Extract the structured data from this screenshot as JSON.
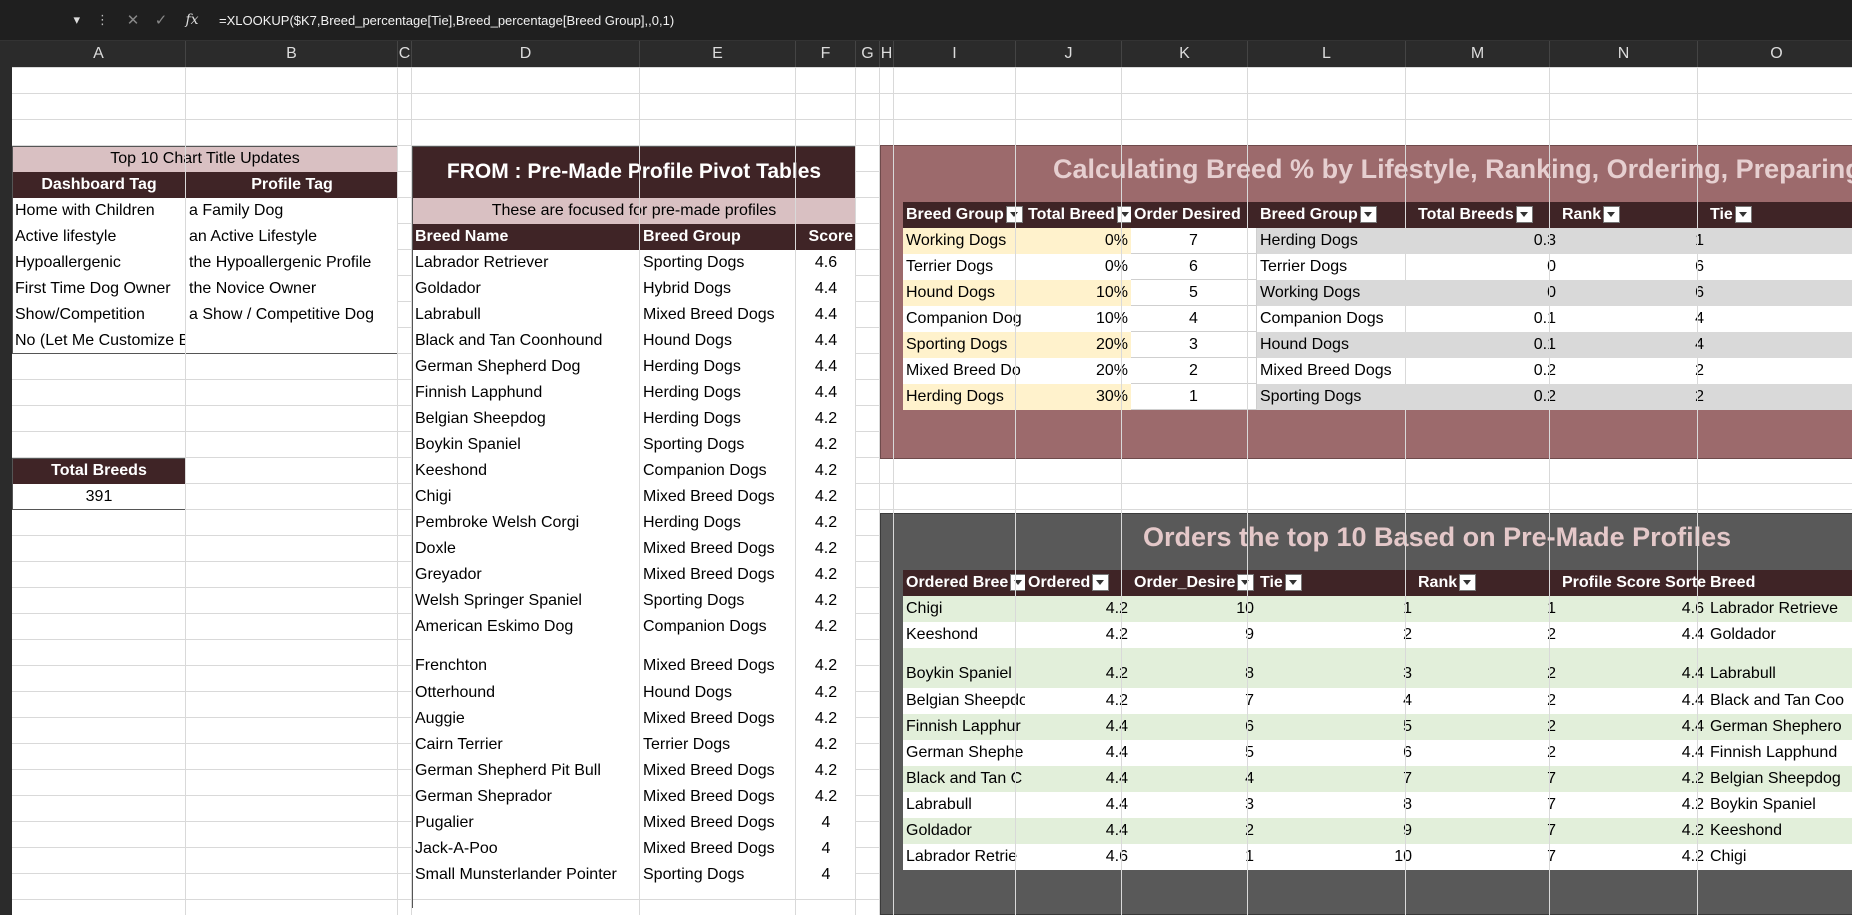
{
  "formula_bar": {
    "formula": "=XLOOKUP($K7,Breed_percentage[Tie],Breed_percentage[Breed Group],,0,1)",
    "fx": "fx"
  },
  "columns": [
    "A",
    "B",
    "C",
    "D",
    "E",
    "F",
    "G",
    "H",
    "I",
    "J",
    "K",
    "L",
    "M",
    "N",
    "O"
  ],
  "left_table": {
    "title": "Top 10 Chart Title Updates",
    "headers": [
      "Dashboard Tag",
      "Profile Tag"
    ],
    "rows": [
      [
        "Home with Children",
        "a Family Dog"
      ],
      [
        "Active lifestyle",
        "an Active Lifestyle"
      ],
      [
        "Hypoallergenic",
        "the Hypoallergenic Profile"
      ],
      [
        "First Time Dog Owner",
        "the Novice Owner"
      ],
      [
        "Show/Competition",
        "a Show / Competitive Dog"
      ],
      [
        "No (Let Me Customize Below)",
        ""
      ]
    ]
  },
  "total_breeds": {
    "label": "Total Breeds",
    "value": "391"
  },
  "pivot": {
    "title": "FROM : Pre-Made Profile Pivot Tables",
    "subtitle": "These are focused for pre-made profiles",
    "headers": [
      "Breed Name",
      "Breed Group",
      "Score"
    ],
    "rows": [
      [
        "Labrador Retriever",
        "Sporting Dogs",
        "4.6"
      ],
      [
        "Goldador",
        "Hybrid Dogs",
        "4.4"
      ],
      [
        "Labrabull",
        "Mixed Breed Dogs",
        "4.4"
      ],
      [
        "Black and Tan Coonhound",
        "Hound Dogs",
        "4.4"
      ],
      [
        "German Shepherd Dog",
        "Herding Dogs",
        "4.4"
      ],
      [
        "Finnish Lapphund",
        "Herding Dogs",
        "4.4"
      ],
      [
        "Belgian Sheepdog",
        "Herding Dogs",
        "4.2"
      ],
      [
        "Boykin Spaniel",
        "Sporting Dogs",
        "4.2"
      ],
      [
        "Keeshond",
        "Companion Dogs",
        "4.2"
      ],
      [
        "Chigi",
        "Mixed Breed Dogs",
        "4.2"
      ],
      [
        "Pembroke Welsh Corgi",
        "Herding Dogs",
        "4.2"
      ],
      [
        "Doxle",
        "Mixed Breed Dogs",
        "4.2"
      ],
      [
        "Greyador",
        "Mixed Breed Dogs",
        "4.2"
      ],
      [
        "Welsh Springer Spaniel",
        "Sporting Dogs",
        "4.2"
      ],
      [
        "American Eskimo Dog",
        "Companion Dogs",
        "4.2"
      ],
      [
        "Frenchton",
        "Mixed Breed Dogs",
        "4.2"
      ],
      [
        "Otterhound",
        "Hound Dogs",
        "4.2"
      ],
      [
        "Auggie",
        "Mixed Breed Dogs",
        "4.2"
      ],
      [
        "Cairn Terrier",
        "Terrier Dogs",
        "4.2"
      ],
      [
        "German Shepherd Pit Bull",
        "Mixed Breed Dogs",
        "4.2"
      ],
      [
        "German Sheprador",
        "Mixed Breed Dogs",
        "4.2"
      ],
      [
        "Pugalier",
        "Mixed Breed Dogs",
        "4"
      ],
      [
        "Jack-A-Poo",
        "Mixed Breed Dogs",
        "4"
      ],
      [
        "Small Munsterlander Pointer",
        "Sporting Dogs",
        "4"
      ]
    ]
  },
  "panel1": {
    "title": "Calculating Breed % by Lifestyle, Ranking, Ordering, Preparing",
    "left_headers": [
      "Breed Group",
      "Total Breed",
      "Order Desired"
    ],
    "left_rows": [
      [
        "Working Dogs",
        "0%",
        "7"
      ],
      [
        "Terrier Dogs",
        "0%",
        "6"
      ],
      [
        "Hound Dogs",
        "10%",
        "5"
      ],
      [
        "Companion Dog",
        "10%",
        "4"
      ],
      [
        "Sporting Dogs",
        "20%",
        "3"
      ],
      [
        "Mixed Breed Do",
        "20%",
        "2"
      ],
      [
        "Herding Dogs",
        "30%",
        "1"
      ]
    ],
    "right_headers": [
      "Breed Group",
      "Total Breeds",
      "Rank",
      "Tie"
    ],
    "right_rows": [
      [
        "Herding Dogs",
        "0.3",
        "1",
        ""
      ],
      [
        "Terrier Dogs",
        "0",
        "6",
        ""
      ],
      [
        "Working Dogs",
        "0",
        "6",
        ""
      ],
      [
        "Companion Dogs",
        "0.1",
        "4",
        ""
      ],
      [
        "Hound Dogs",
        "0.1",
        "4",
        ""
      ],
      [
        "Mixed Breed Dogs",
        "0.2",
        "2",
        ""
      ],
      [
        "Sporting Dogs",
        "0.2",
        "2",
        ""
      ]
    ]
  },
  "panel2": {
    "title": "Orders the top 10 Based on Pre-Made Profiles",
    "headers": [
      "Ordered Bree",
      "Ordered",
      "Order_Desire",
      "Tie",
      "Rank",
      "Profile Score Sorte",
      "Breed"
    ],
    "rows": [
      [
        "Chigi",
        "4.2",
        "10",
        "1",
        "1",
        "4.6",
        "Labrador Retrieve"
      ],
      [
        "Keeshond",
        "4.2",
        "9",
        "2",
        "2",
        "4.4",
        "Goldador"
      ],
      [
        "Boykin Spaniel",
        "4.2",
        "8",
        "3",
        "2",
        "4.4",
        "Labrabull"
      ],
      [
        "Belgian Sheepdo",
        "4.2",
        "7",
        "4",
        "2",
        "4.4",
        "Black and Tan Coo"
      ],
      [
        "Finnish Lapphur",
        "4.4",
        "6",
        "5",
        "2",
        "4.4",
        "German Shephero"
      ],
      [
        "German Shephe",
        "4.4",
        "5",
        "6",
        "2",
        "4.4",
        "Finnish Lapphund"
      ],
      [
        "Black and Tan C",
        "4.4",
        "4",
        "7",
        "7",
        "4.2",
        "Belgian Sheepdog"
      ],
      [
        "Labrabull",
        "4.4",
        "3",
        "8",
        "7",
        "4.2",
        "Boykin Spaniel"
      ],
      [
        "Goldador",
        "4.4",
        "2",
        "9",
        "7",
        "4.2",
        "Keeshond"
      ],
      [
        "Labrador Retrie",
        "4.6",
        "1",
        "10",
        "7",
        "4.2",
        "Chigi"
      ]
    ]
  }
}
